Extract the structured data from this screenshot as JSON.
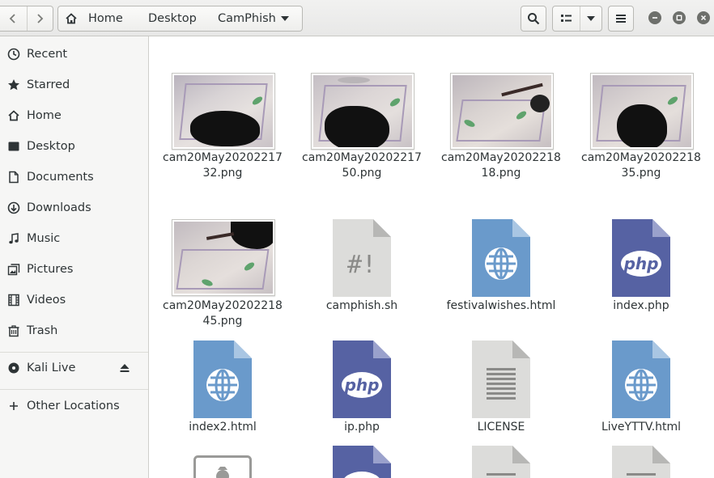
{
  "pathbar": {
    "crumbs": [
      "Home",
      "Desktop",
      "CamPhish"
    ]
  },
  "sidebar": {
    "items": [
      {
        "label": "Recent",
        "icon": "clock-icon"
      },
      {
        "label": "Starred",
        "icon": "star-icon"
      },
      {
        "label": "Home",
        "icon": "home-icon"
      },
      {
        "label": "Desktop",
        "icon": "desktop-icon"
      },
      {
        "label": "Documents",
        "icon": "document-icon"
      },
      {
        "label": "Downloads",
        "icon": "download-icon"
      },
      {
        "label": "Music",
        "icon": "music-icon"
      },
      {
        "label": "Pictures",
        "icon": "pictures-icon"
      },
      {
        "label": "Videos",
        "icon": "video-icon"
      },
      {
        "label": "Trash",
        "icon": "trash-icon"
      }
    ],
    "devices": [
      {
        "label": "Kali Live",
        "icon": "disc-icon"
      }
    ],
    "other": {
      "label": "Other Locations",
      "icon": "plus-icon"
    }
  },
  "files": [
    {
      "line1": "cam20May20202217",
      "line2": "32.png",
      "type": "image"
    },
    {
      "line1": "cam20May20202217",
      "line2": "50.png",
      "type": "image"
    },
    {
      "line1": "cam20May20202218",
      "line2": "18.png",
      "type": "image"
    },
    {
      "line1": "cam20May20202218",
      "line2": "35.png",
      "type": "image"
    },
    {
      "line1": "cam20May20202218",
      "line2": "45.png",
      "type": "image"
    },
    {
      "line1": "camphish.sh",
      "line2": "",
      "type": "script"
    },
    {
      "line1": "festivalwishes.html",
      "line2": "",
      "type": "html"
    },
    {
      "line1": "index.php",
      "line2": "",
      "type": "php"
    },
    {
      "line1": "index2.html",
      "line2": "",
      "type": "html"
    },
    {
      "line1": "ip.php",
      "line2": "",
      "type": "php"
    },
    {
      "line1": "LICENSE",
      "line2": "",
      "type": "text"
    },
    {
      "line1": "LiveYTTV.html",
      "line2": "",
      "type": "html"
    }
  ],
  "icons": {
    "php_text": "php",
    "script_text": "#!"
  },
  "colors": {
    "html_blue": "#6a9acb",
    "php_purple": "#5662a3",
    "text_gray": "#dcdcda"
  }
}
